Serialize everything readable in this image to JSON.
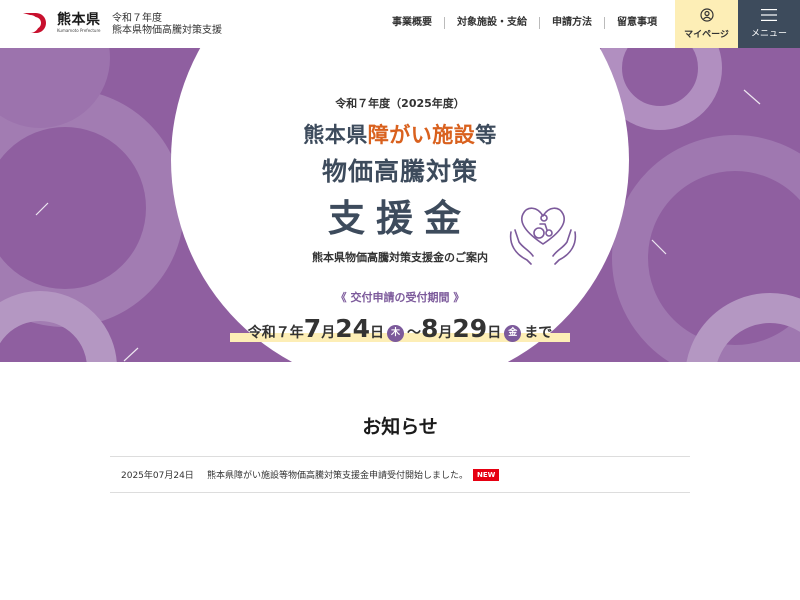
{
  "header": {
    "logo_name": "熊本県",
    "logo_sub": "Kumamoto Prefecture",
    "site_title_line1": "令和７年度",
    "site_title_line2": "熊本県物価高騰対策支援",
    "nav": [
      "事業概要",
      "対象施設・支給",
      "申請方法",
      "留意事項"
    ],
    "mypage_label": "マイページ",
    "menu_label": "メニュー"
  },
  "hero": {
    "year": "令和７年度（2025年度）",
    "line1_pre": "熊本県",
    "line1_accent": "障がい施設",
    "line1_post": "等",
    "line2": "物価高騰対策",
    "line3": "支援金",
    "guide": "熊本県物価高騰対策支援金のご案内",
    "period_label": "《 交付申請の受付期間 》",
    "period": {
      "era": "令和７年",
      "start_month": "7",
      "month_unit": "月",
      "start_day": "24",
      "day_unit": "日",
      "start_weekday": "木",
      "tilde": "～",
      "end_month": "8",
      "end_day": "29",
      "end_weekday": "金",
      "until": "まで"
    }
  },
  "news": {
    "title": "お知らせ",
    "items": [
      {
        "date": "2025年07月24日",
        "text": "熊本県障がい施設等物価高騰対策支援金申請受付開始しました。",
        "badge": "NEW"
      }
    ]
  },
  "colors": {
    "hero_bg": "#8f5fa0",
    "accent_orange": "#d9611e",
    "navy": "#3d4b5c",
    "purple": "#7c5a9b",
    "highlight_yellow": "#fdeeb6",
    "new_badge": "#e60012",
    "logo_red": "#c8102e"
  },
  "icons": {
    "mypage": "user-circle-icon",
    "menu": "hamburger-icon",
    "hero": "hands-heart-icon"
  }
}
